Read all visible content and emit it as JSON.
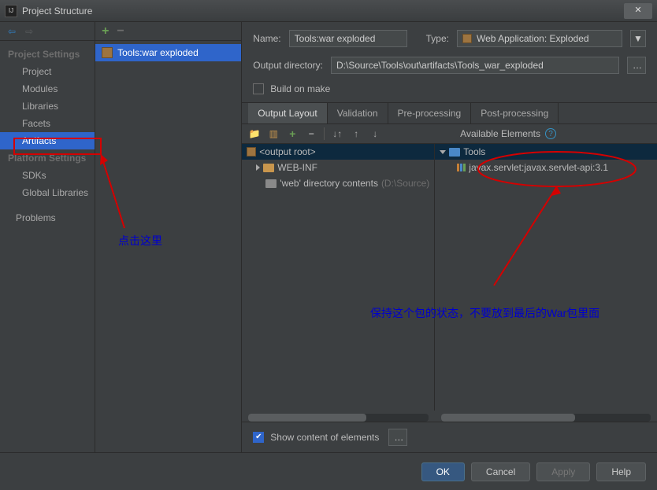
{
  "window": {
    "title": "Project Structure"
  },
  "sidebar": {
    "groups": [
      {
        "heading": "Project Settings",
        "items": [
          "Project",
          "Modules",
          "Libraries",
          "Facets",
          "Artifacts"
        ]
      },
      {
        "heading": "Platform Settings",
        "items": [
          "SDKs",
          "Global Libraries"
        ]
      },
      {
        "heading": "",
        "items": [
          "Problems"
        ]
      }
    ],
    "selected": "Artifacts"
  },
  "artifactsList": {
    "items": [
      "Tools:war exploded"
    ],
    "selected": 0
  },
  "form": {
    "nameLabel": "Name:",
    "nameValue": "Tools:war exploded",
    "typeLabel": "Type:",
    "typeValue": "Web Application: Exploded",
    "outDirLabel": "Output directory:",
    "outDirValue": "D:\\Source\\Tools\\out\\artifacts\\Tools_war_exploded",
    "buildOnMakeLabel": "Build on make",
    "buildOnMakeChecked": false
  },
  "tabs": [
    "Output Layout",
    "Validation",
    "Pre-processing",
    "Post-processing"
  ],
  "toolbar": {
    "availableLabel": "Available Elements"
  },
  "outputTree": {
    "root": "<output root>",
    "children": [
      {
        "label": "WEB-INF",
        "kind": "folder",
        "expandable": true
      },
      {
        "label": "'web' directory contents",
        "suffix": "(D:\\Source)",
        "kind": "dir-contents"
      }
    ]
  },
  "availableTree": {
    "root": "Tools",
    "children": [
      {
        "label": "javax.servlet:javax.servlet-api:3.1",
        "kind": "library"
      }
    ]
  },
  "bottom": {
    "showContentsLabel": "Show content of elements",
    "checked": true
  },
  "buttons": {
    "ok": "OK",
    "cancel": "Cancel",
    "apply": "Apply",
    "help": "Help"
  },
  "annotations": {
    "clickHere": "点击这里",
    "keepPkg": "保持这个包的状态，不要放到最后的War包里面"
  }
}
